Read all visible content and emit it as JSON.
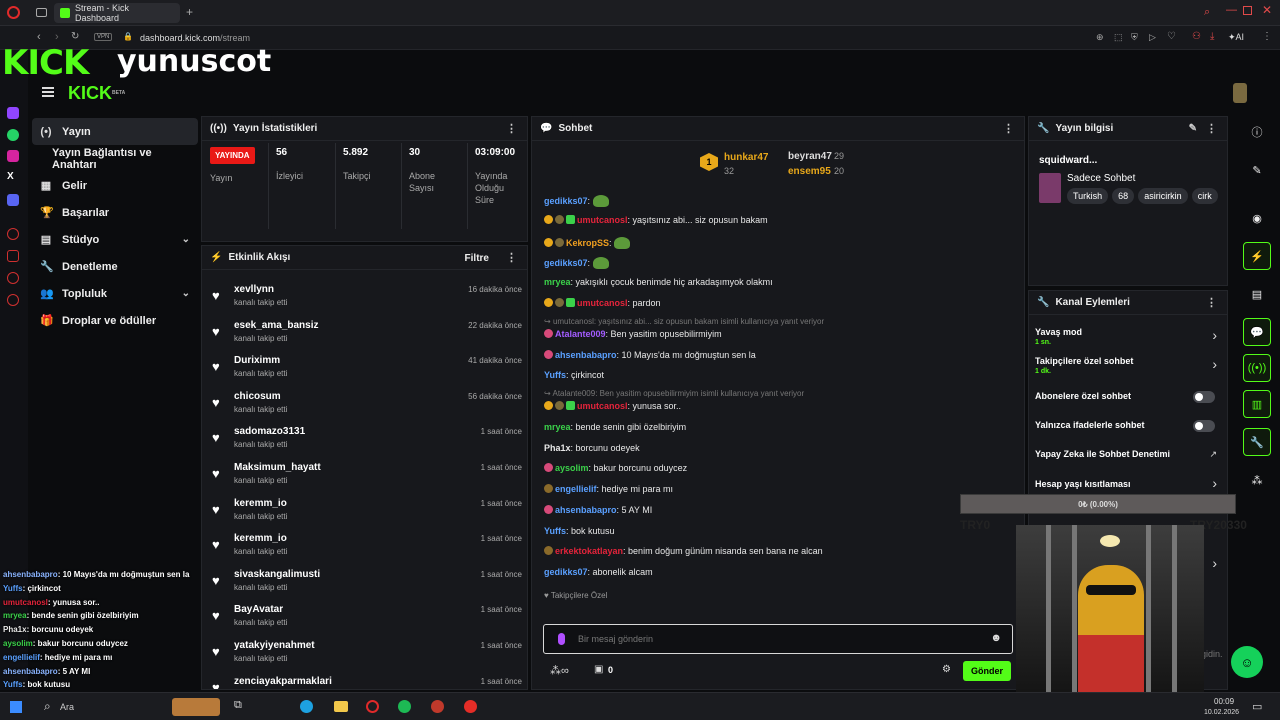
{
  "browser": {
    "tab_title": "Stream - Kick Dashboard",
    "new_tab": "+",
    "vpn": "VPN",
    "url_host": "dashboard.kick.com",
    "url_path": "/stream",
    "ai_label": "AI"
  },
  "overlay": {
    "logo": "KICK",
    "username": "yunuscot"
  },
  "header": {
    "logo": "KICK",
    "beta": "BETA"
  },
  "nav": {
    "items": [
      {
        "icon": "(•)",
        "label": "Yayın"
      },
      {
        "icon": "",
        "label": "Yayın Bağlantısı ve Anahtarı"
      },
      {
        "icon": "▦",
        "label": "Gelir"
      },
      {
        "icon": "🏆",
        "label": "Başarılar"
      },
      {
        "icon": "▤",
        "label": "Stüdyo",
        "chevron": "⌄"
      },
      {
        "icon": "🔧",
        "label": "Denetleme"
      },
      {
        "icon": "👥",
        "label": "Topluluk",
        "chevron": "⌄"
      },
      {
        "icon": "🎁",
        "label": "Droplar ve ödüller"
      }
    ]
  },
  "stats": {
    "title": "Yayın İstatistikleri",
    "live": "YAYINDA",
    "live_label": "Yayın",
    "viewers": "56",
    "viewers_label": "İzleyici",
    "followers": "5.892",
    "followers_label": "Takipçi",
    "subs": "30",
    "subs_label": "Abone Sayısı",
    "uptime": "03:09:00",
    "uptime_label": "Yayında Olduğu Süre"
  },
  "activity": {
    "title": "Etkinlik Akışı",
    "filter": "Filtre",
    "events": [
      {
        "name": "xevllynn",
        "sub": "kanalı takip etti",
        "time": "16 dakika önce"
      },
      {
        "name": "esek_ama_bansiz",
        "sub": "kanalı takip etti",
        "time": "22 dakika önce"
      },
      {
        "name": "Duriximm",
        "sub": "kanalı takip etti",
        "time": "41 dakika önce"
      },
      {
        "name": "chicosum",
        "sub": "kanalı takip etti",
        "time": "56 dakika önce"
      },
      {
        "name": "sadomazo3131",
        "sub": "kanalı takip etti",
        "time": "1 saat önce"
      },
      {
        "name": "Maksimum_hayatt",
        "sub": "kanalı takip etti",
        "time": "1 saat önce"
      },
      {
        "name": "keremm_io",
        "sub": "kanalı takip etti",
        "time": "1 saat önce"
      },
      {
        "name": "keremm_io",
        "sub": "kanalı takip etti",
        "time": "1 saat önce"
      },
      {
        "name": "sivaskangalimusti",
        "sub": "kanalı takip etti",
        "time": "1 saat önce"
      },
      {
        "name": "BayAvatar",
        "sub": "kanalı takip etti",
        "time": "1 saat önce"
      },
      {
        "name": "yatakyiyenahmet",
        "sub": "kanalı takip etti",
        "time": "1 saat önce"
      },
      {
        "name": "zenciayakparmaklari",
        "sub": "",
        "time": "1 saat önce"
      }
    ]
  },
  "chat": {
    "title": "Sohbet",
    "leaders": [
      {
        "rank": "1",
        "name": "hunkar47",
        "count": "32"
      },
      {
        "name": "beyran47",
        "count": "29"
      },
      {
        "name": "ensem95",
        "count": "20"
      }
    ],
    "messages": [
      {
        "user": "gedikks07",
        "color": "#5aa0ff",
        "text": ""
      },
      {
        "user": "umutcanosl",
        "color": "#e4243b",
        "text": ": yaşıtsınız abi... siz opusun bakam"
      },
      {
        "user": "KekropSS",
        "color": "#f0a020",
        "text": ""
      },
      {
        "user": "gedikks07",
        "color": "#5aa0ff",
        "text": ""
      },
      {
        "user": "mryea",
        "color": "#3bd14a",
        "text": ": yakışıklı çocuk benimde hiç arkadaşımyok olakmı"
      },
      {
        "user": "umutcanosl",
        "color": "#e4243b",
        "text": ": pardon"
      },
      {
        "reply": "umutcanosl: yaşıtsınız abi... siz opusun bakam isimli kullanıcıya yanıt veriyor"
      },
      {
        "user": "Atalante009",
        "color": "#a35cff",
        "text": ": Ben yasitim opusebilirmiyim"
      },
      {
        "user": "ahsenbabapro",
        "color": "#5aa0ff",
        "text": ": 10 Mayıs'da mı doğmuştun sen la"
      },
      {
        "user": "Yuffs",
        "color": "#5aa0ff",
        "text": ": çirkincot"
      },
      {
        "reply": "Atalante009: Ben yasitim opusebilirmiyim isimli kullanıcıya yanıt veriyor"
      },
      {
        "user": "umutcanosl",
        "color": "#e4243b",
        "text": ": yunusa sor.."
      },
      {
        "user": "mryea",
        "color": "#3bd14a",
        "text": ": bende senin gibi özelbiriyim"
      },
      {
        "user": "Pha1x",
        "color": "#e8e8e8",
        "text": ": borcunu odeyek"
      },
      {
        "user": "aysolim",
        "color": "#3bd14a",
        "text": ": bakur borcunu oduycez"
      },
      {
        "user": "engellielif",
        "color": "#5aa0ff",
        "text": ": hediye mi para mı"
      },
      {
        "user": "ahsenbabapro",
        "color": "#5aa0ff",
        "text": ": 5 AY MI"
      },
      {
        "user": "Yuffs",
        "color": "#5aa0ff",
        "text": ": bok kutusu"
      },
      {
        "user": "erkektokatlayan",
        "color": "#e4243b",
        "text": ": benim doğum günüm nisanda sen bana ne alcan"
      },
      {
        "user": "gedikks07",
        "color": "#5aa0ff",
        "text": ": abonelik alcam"
      }
    ],
    "followers_only": "Takipçilere Özel",
    "placeholder": "Bir mesaj gönderin",
    "loop_icon": "∞",
    "count": "0",
    "send": "Gönder"
  },
  "stream_info": {
    "title": "Yayın bilgisi",
    "stream_title": "squidward...",
    "category": "Sadece Sohbet",
    "tags": [
      "Turkish",
      "68",
      "asiricirkin",
      "cirk"
    ]
  },
  "channel_actions": {
    "title": "Kanal Eylemleri",
    "items": [
      {
        "label": "Yavaş mod",
        "sub": "1 sn."
      },
      {
        "label": "Takipçilere özel sohbet",
        "sub": "1 dk."
      },
      {
        "label": "Abonelere özel sohbet"
      },
      {
        "label": "Yalnızca ifadelerle sohbet"
      },
      {
        "label": "Yapay Zeka ile Sohbet Denetimi"
      },
      {
        "label": "Hesap yaşı kısıtlaması"
      }
    ]
  },
  "donation_overlay": {
    "progress": "0₺ (0.00%)",
    "start": "TRY0",
    "goal": "TRY20330",
    "fraction": 0,
    "partial": "gidin."
  },
  "stream_overlay_chat": [
    {
      "user": "ahsenbabapro",
      "text": ": 10 Mayıs'da mı doğmuştun sen la",
      "color": "#8ab4ff"
    },
    {
      "user": "Yuffs",
      "text": ": çirkincot",
      "color": "#5aa0ff"
    },
    {
      "user": "umutcanosl",
      "text": ": yunusa sor..",
      "color": "#e4243b"
    },
    {
      "user": "mryea",
      "text": ": bende senin gibi özelbiriyim",
      "color": "#3bd14a"
    },
    {
      "user": "Pha1x",
      "text": ": borcunu odeyek",
      "color": "#e8e8e8"
    },
    {
      "user": "aysolim",
      "text": ": bakur borcunu oduycez",
      "color": "#3bd14a"
    },
    {
      "user": "engellielif",
      "text": ": hediye mi para mı",
      "color": "#5aa0ff"
    },
    {
      "user": "ahsenbabapro",
      "text": ": 5 AY MI",
      "color": "#8ab4ff"
    },
    {
      "user": "Yuffs",
      "text": ": bok kutusu",
      "color": "#5aa0ff"
    },
    {
      "user": "erkektokatlayan",
      "text": ": benim doğum günüm nisanda sen bana ne alcan",
      "color": "#e4243b"
    },
    {
      "user": "gedikks07",
      "text": ": abonelik alcam",
      "color": "#5aa0ff"
    }
  ],
  "taskbar": {
    "search": "Ara",
    "time": "00:09",
    "date": "10.02.2026"
  },
  "colors": {
    "accent": "#53fc18",
    "live": "#e91916",
    "panel": "#17181c"
  }
}
